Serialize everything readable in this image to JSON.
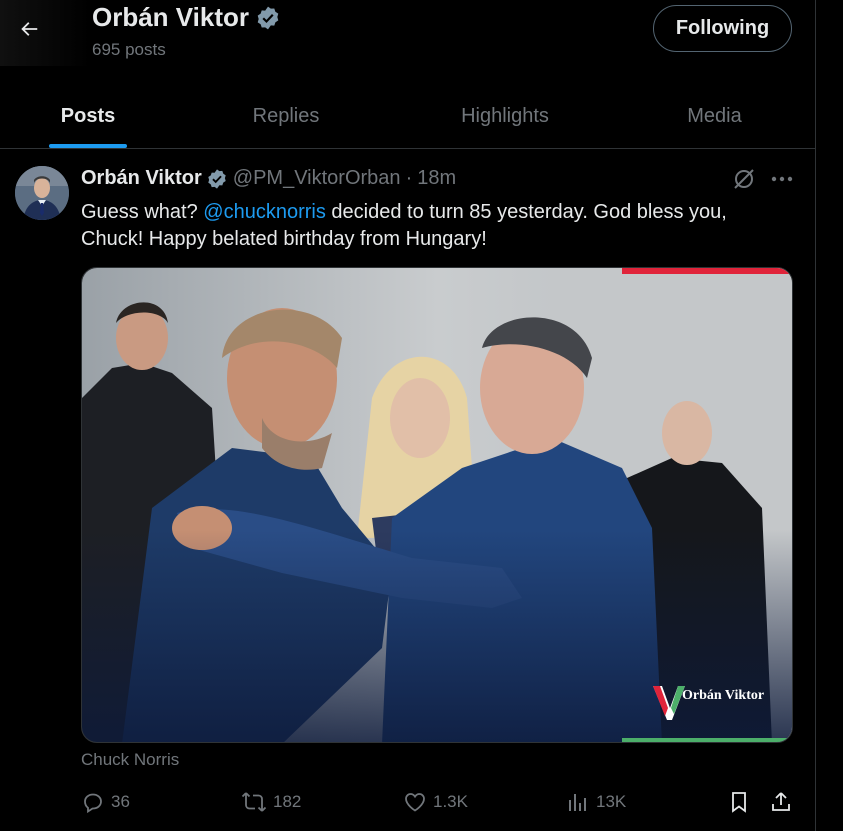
{
  "header": {
    "profile_name": "Orbán Viktor",
    "post_count": "695 posts",
    "follow_button": "Following"
  },
  "tabs": [
    {
      "label": "Posts",
      "active": true
    },
    {
      "label": "Replies",
      "active": false
    },
    {
      "label": "Highlights",
      "active": false
    },
    {
      "label": "Media",
      "active": false
    }
  ],
  "tweet": {
    "author_name": "Orbán Viktor",
    "handle": "@PM_ViktorOrban",
    "separator": "·",
    "time": "18m",
    "text_before": "Guess what? ",
    "mention": "@chucknorris",
    "text_after": " decided to turn 85 yesterday. God bless you, Chuck! Happy belated birthday from Hungary!",
    "media_watermark": "Orbán Viktor",
    "media_caption": "Chuck Norris",
    "stats": {
      "replies": "36",
      "reposts": "182",
      "likes": "1.3K",
      "views": "13K"
    }
  },
  "colors": {
    "accent": "#1d9bf0",
    "verified_badge": "#829aab",
    "muted_text": "#71767b",
    "flag_red": "#e0243a",
    "flag_green": "#4caf6a"
  },
  "icons": [
    "back-arrow-icon",
    "verified-badge-icon",
    "grok-icon",
    "more-icon",
    "reply-icon",
    "repost-icon",
    "like-icon",
    "views-icon",
    "bookmark-icon",
    "share-icon"
  ]
}
